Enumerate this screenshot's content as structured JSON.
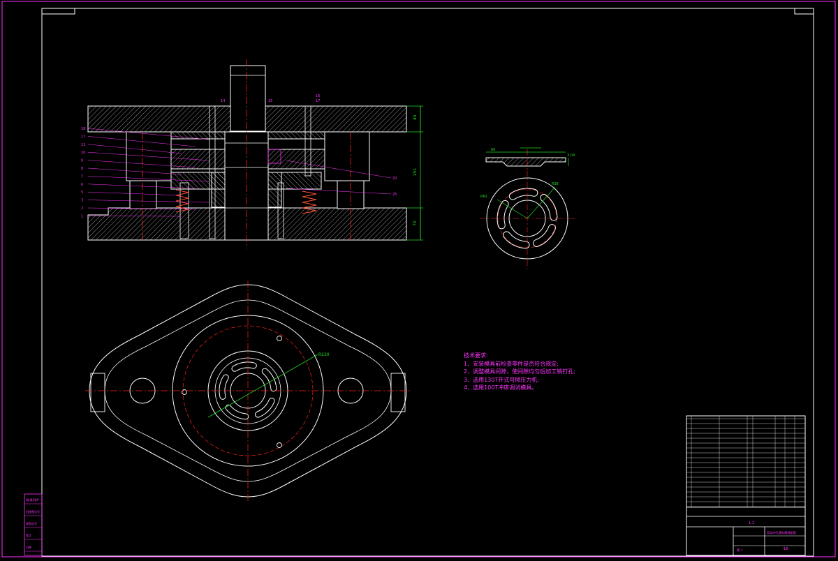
{
  "colors": {
    "background": "#000000",
    "outline": "#ffffff",
    "frame": "#ff33ff",
    "centerline": "#ff2222",
    "dimension": "#22dd22",
    "hatch": "#ffffff",
    "spring": "#ff5533",
    "annotation": "#ff33ff"
  },
  "drawing": {
    "section_view_callouts_left": [
      "18",
      "17",
      "11",
      "10",
      "9",
      "8",
      "7",
      "6",
      "5",
      "3",
      "2",
      "1"
    ],
    "section_view_callouts_top": [
      "14",
      "15",
      "16",
      "17"
    ],
    "section_view_callouts_right": [
      "20",
      "25"
    ],
    "section_dims": [
      "45",
      "251",
      "70"
    ],
    "part_dims_top": [
      "60",
      "3.04"
    ],
    "part_dims_radial": [
      "R62",
      "R38"
    ],
    "plan_dim": "R230",
    "technical_notes": {
      "title": "技术要求:",
      "items": [
        "1、安装模具前检查零件是否符合规定;",
        "2、调整模具间隙，使间隙均匀后加工销钉孔;",
        "3、选用130T开式可倾压力机;",
        "4、选用100T冲床调试模具。"
      ]
    },
    "title_block": {
      "scale": "1:1",
      "title": "双动冲孔落料模装配图",
      "drawing_no": "-18-",
      "sheet": "第 1"
    },
    "side_stamp": [
      "借(通)用件",
      "旧底图总号",
      "底图总号",
      "签字",
      "日期"
    ]
  }
}
